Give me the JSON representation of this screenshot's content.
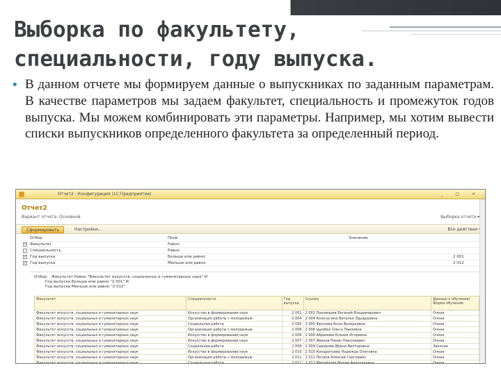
{
  "slide": {
    "title_line1": "Выборка по факультету,",
    "title_line2": "специальности, году выпуска.",
    "bullet_symbol": "•",
    "bullet_text": "В данном отчете мы формируем данные о выпускниках по заданным параметрам. В качестве параметров мы задаем факультет, специальность и промежуток годов выпуска. Мы можем комбинировать эти параметры. Например, мы хотим вывести списки выпускников определенного факультета за определенный период."
  },
  "screenshot": {
    "window_title": "Отчет2 - Конфигурация (1С:Предприятие)",
    "window_controls": "_ □ ×",
    "report_title": "Отчет2",
    "variant_label": "Вариант отчета: Основной",
    "more_button": "Выборка отчета ▾",
    "form_button": "Сформировать",
    "settings_button": "Настройки...",
    "toolbar_right": "Все действия ▾",
    "params_header": {
      "c1": "Отбор",
      "c2": "Поле",
      "c3": "Вид сравнения",
      "c4": "Значение"
    },
    "params": [
      {
        "checked": true,
        "name": "Факультет",
        "cond": "Равно",
        "value": ""
      },
      {
        "checked": false,
        "name": "Специальность",
        "cond": "Равно",
        "value": ""
      },
      {
        "checked": true,
        "name": "Год выпуска",
        "cond": "Больше или равно",
        "value": "2 001"
      },
      {
        "checked": true,
        "name": "Год выпуска",
        "cond": "Меньше или равно",
        "value": "2 012"
      }
    ],
    "selection_lines": [
      "Отбор:   Факультет Равно \"Факультет искусств, социальных и гуманитарных наук\" И",
      "         Год выпуска Больше или равно \"2 001\" И",
      "         Год выпуска Меньше или равно \"2 012\""
    ],
    "table_headers": [
      "Факультет",
      "Специальность",
      "Год выпуска",
      "Ссылка",
      "Данные о обучении/Форма обучения"
    ],
    "table_rows": [
      [
        "Факультет искусств, социальных и гуманитарных наук",
        "Искусство в формировании наук",
        "2 001",
        "2 001 Пономарев Евгений Владимирович",
        "Очная"
      ],
      [
        "Факультет искусств, социальных и гуманитарных наук",
        "Организация работы с молодежью",
        "2 004",
        "2 004 Кольчугина Виталья Эдуардовна",
        "Очная"
      ],
      [
        "Факультет искусств, социальных и гуманитарных наук",
        "Социальная работа",
        "2 005",
        "2 005 Фролова Анна Валерьевна",
        "Очная"
      ],
      [
        "Факультет искусств, социальных и гуманитарных наук",
        "Организация работы с молодежью",
        "2 006",
        "2 006 Цымбал Ольга Павловна",
        "Очная"
      ],
      [
        "Факультет искусств, социальных и гуманитарных наук",
        "Искусство в формировании наук",
        "2 006",
        "2 006 Абрамова Ксения Игоревна",
        "Очная"
      ],
      [
        "Факультет искусств, социальных и гуманитарных наук",
        "Искусство в формировании наук",
        "2 007",
        "2 007 Иванов Роман Николаевич",
        "Очная"
      ],
      [
        "Факультет искусств, социальных и гуманитарных наук",
        "Социальная работа",
        "2 009",
        "2 009 Сидорова Ирина Викторовна",
        "Заочная"
      ],
      [
        "Факультет искусств, социальных и гуманитарных наук",
        "Искусство в формировании наук",
        "2 010",
        "2 010 Кондратьева Надежда Олеговна",
        "Очная"
      ],
      [
        "Факультет искусств, социальных и гуманитарных наук",
        "Организация работы с молодежью",
        "2 011",
        "2 011 Петров Алексей Сергеевич",
        "Очная"
      ],
      [
        "Факультет искусств, социальных и гуманитарных наук",
        "Социальная работа",
        "2 012",
        "2 012 Михайлова Мария Анатольевна",
        "Очная"
      ]
    ]
  }
}
